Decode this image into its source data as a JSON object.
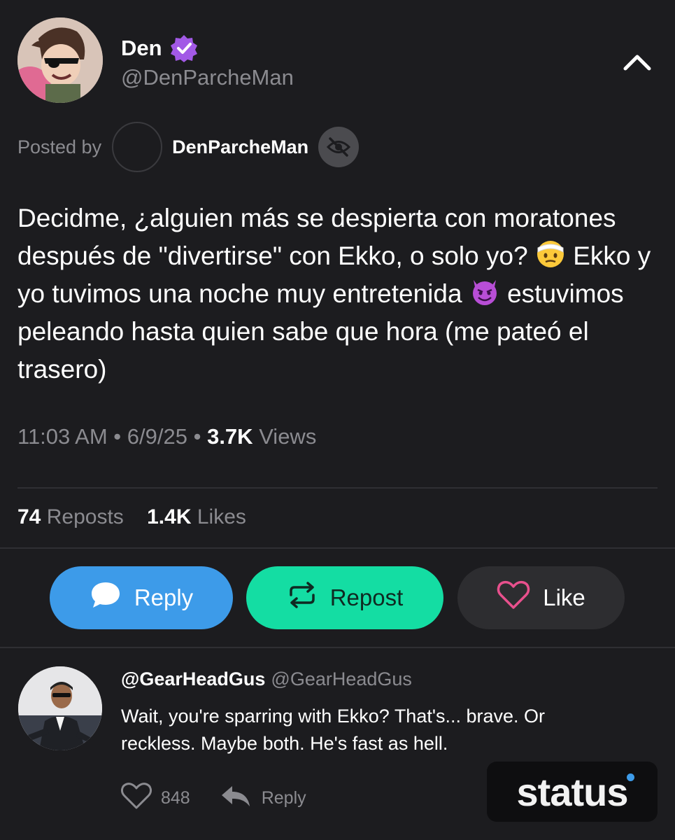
{
  "post": {
    "author_name": "Den",
    "author_handle": "@DenParcheMan",
    "posted_by_label": "Posted by",
    "posted_by_user": "DenParcheMan",
    "text_parts": [
      "Decidme, ¿alguien más se despierta con moratones después de \"divertirse\" con Ekko, o solo yo? ",
      " Ekko y yo tuvimos una noche muy entretenida ",
      " estuvimos peleando hasta quien sabe que hora (me pateó el trasero)"
    ],
    "emojis": [
      "injured-face-emoji",
      "smiling-devil-emoji"
    ],
    "time": "11:03 AM",
    "date": "6/9/25",
    "views_count": "3.7K",
    "views_label": "Views",
    "reposts_count": "74",
    "reposts_label": "Reposts",
    "likes_count": "1.4K",
    "likes_label": "Likes"
  },
  "actions": {
    "reply_label": "Reply",
    "repost_label": "Repost",
    "like_label": "Like"
  },
  "reply": {
    "name": "@GearHeadGus",
    "handle": "@GearHeadGus",
    "text": "Wait, you're sparring with Ekko? That's... brave. Or reckless. Maybe both. He's fast as hell.",
    "like_count": "848",
    "reply_label": "Reply"
  },
  "watermark": {
    "text": "status"
  },
  "colors": {
    "background": "#1c1c1f",
    "reply_button": "#3d9be9",
    "repost_button": "#14dda3",
    "like_button": "#2d2d30",
    "verified_badge": "#a259e6",
    "like_heart": "#e8508d"
  },
  "icons": [
    "verified-badge-icon",
    "chevron-up-icon",
    "eye-slash-icon",
    "chat-bubble-icon",
    "repost-arrows-icon",
    "heart-icon",
    "reply-arrow-icon"
  ]
}
